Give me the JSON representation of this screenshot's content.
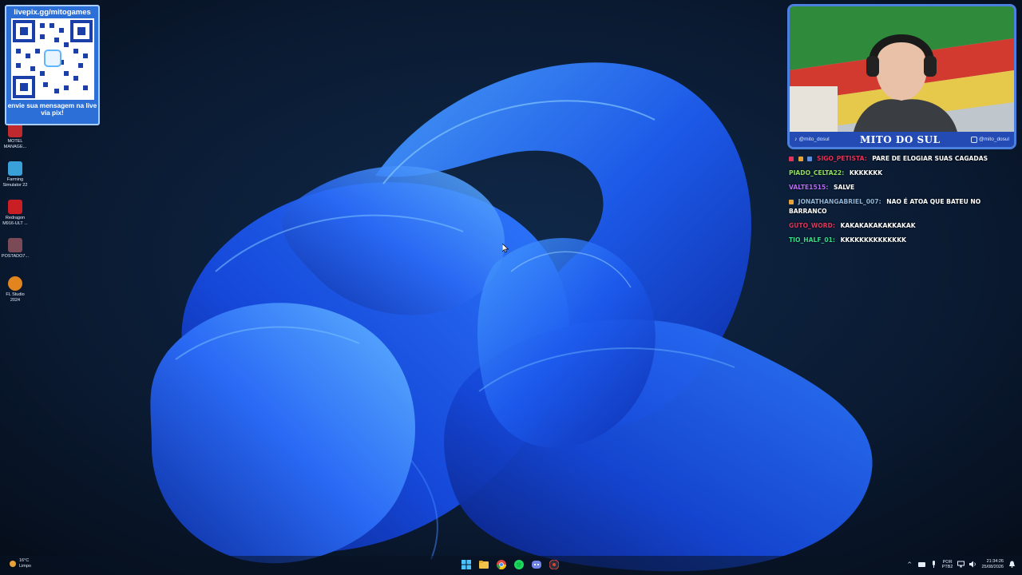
{
  "desktop": {
    "icons": [
      {
        "label": "MOTEL\nMANAGE...",
        "icon": "motel-manager-icon",
        "color": "#c0292d"
      },
      {
        "label": "Farming\nSimulator 22",
        "icon": "farming-simulator-icon",
        "color": "#3aa0d8"
      },
      {
        "label": "Redragon\nM916-ULT ...",
        "icon": "redragon-icon",
        "color": "#c81e24"
      },
      {
        "label": "POSTADO7...",
        "icon": "file-icon",
        "color": "#7a4a56"
      },
      {
        "label": "FL Studio\n2024",
        "icon": "fl-studio-icon",
        "color": "#e2851f"
      }
    ]
  },
  "qr_overlay": {
    "url": "livepix.gg/mitogames",
    "caption": "envie sua mensagem na live via pix!",
    "accent": "#2c6fd6"
  },
  "webcam": {
    "name": "MITO DO SUL",
    "handle_left": "@mito_dosul",
    "handle_right": "@mito_dosul",
    "accent": "#4b7fe0"
  },
  "chat": {
    "messages": [
      {
        "user": "SIGO_PETISTA:",
        "text": "PARE DE ELOGIAR SUAS CAGADAS",
        "color": "#e0345b"
      },
      {
        "user": "PIADO_CELTA22:",
        "text": "KKKKKKK",
        "color": "#8ee05a"
      },
      {
        "user": "VALTE1515:",
        "text": "SALVE",
        "color": "#b56cf0"
      },
      {
        "user": "JONATHANGABRIEL_007:",
        "text": "NAO É ATOA QUE BATEU NO BARRANCO",
        "color": "#8fb4d8"
      },
      {
        "user": "GUTO_WORD:",
        "text": "KAKAKAKAKAKKAKAK",
        "color": "#e0345b"
      },
      {
        "user": "TIO_HALF_01:",
        "text": "KKKKKKKKKKKKKK",
        "color": "#3ad88a"
      }
    ]
  },
  "taskbar": {
    "weather_temp": "16°C",
    "weather_desc": "Limpo",
    "lang_line1": "POR",
    "lang_line2": "PTB2",
    "time": "21:34:26",
    "date": "25/08/2026",
    "apps": [
      "windows-start-icon",
      "file-explorer-icon",
      "chrome-icon",
      "spotify-icon",
      "discord-icon",
      "obs-icon"
    ]
  }
}
